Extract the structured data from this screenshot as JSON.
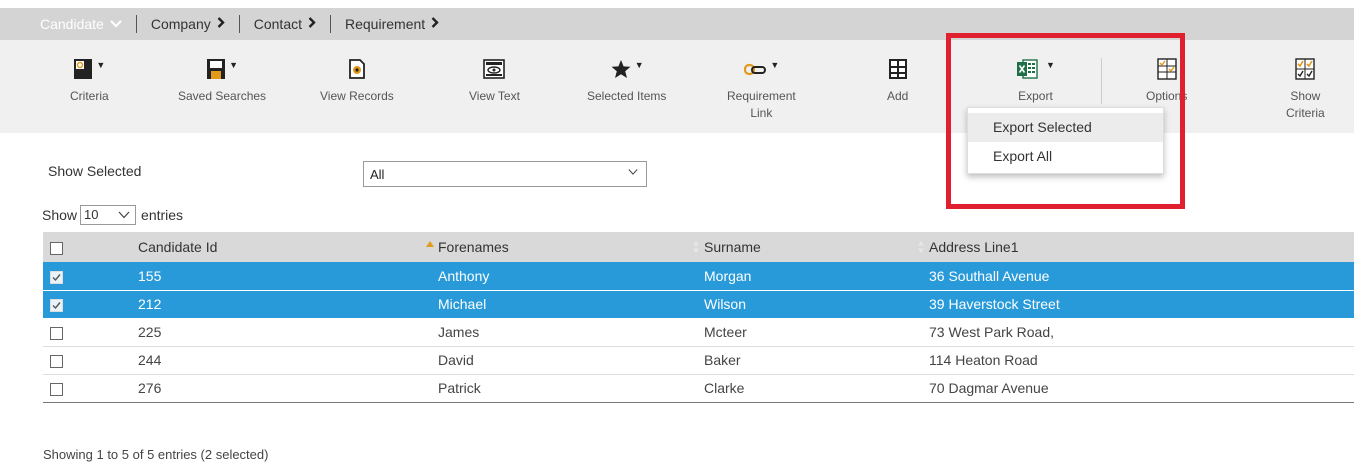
{
  "breadcrumb": [
    {
      "label": "Candidate",
      "active": true,
      "chevron": "chevron-down"
    },
    {
      "label": "Company",
      "active": false,
      "chevron": "chevron-right"
    },
    {
      "label": "Contact",
      "active": false,
      "chevron": "chevron-right"
    },
    {
      "label": "Requirement",
      "active": false,
      "chevron": "chevron-right"
    }
  ],
  "toolbar": {
    "criteria": "Criteria",
    "saved_searches": "Saved Searches",
    "view_records": "View Records",
    "view_text": "View Text",
    "selected_items": "Selected Items",
    "requirement_link_1": "Requirement",
    "requirement_link_2": "Link",
    "add": "Add",
    "export": "Export",
    "options": "Options",
    "show_criteria_1": "Show",
    "show_criteria_2": "Criteria"
  },
  "export_menu": {
    "items": [
      "Export Selected",
      "Export All"
    ],
    "hovered": "Export Selected"
  },
  "filter": {
    "label": "Show Selected",
    "value": "All"
  },
  "entries": {
    "prefix": "Show",
    "value": "10",
    "suffix": "entries"
  },
  "table": {
    "columns": [
      "Candidate Id",
      "Forenames",
      "Surname",
      "Address Line1"
    ],
    "sorted_column": "Candidate Id",
    "rows": [
      {
        "id": "155",
        "forenames": "Anthony",
        "surname": "Morgan",
        "address": "36 Southall Avenue",
        "selected": true
      },
      {
        "id": "212",
        "forenames": "Michael",
        "surname": "Wilson",
        "address": "39 Haverstock Street",
        "selected": true
      },
      {
        "id": "225",
        "forenames": "James",
        "surname": "Mcteer",
        "address": "73 West Park Road,",
        "selected": false
      },
      {
        "id": "244",
        "forenames": "David",
        "surname": "Baker",
        "address": "114 Heaton Road",
        "selected": false
      },
      {
        "id": "276",
        "forenames": "Patrick",
        "surname": "Clarke",
        "address": "70 Dagmar Avenue",
        "selected": false
      }
    ]
  },
  "footer": {
    "info": "Showing 1 to 5 of 5 entries (2 selected)"
  },
  "colors": {
    "selected_row": "#289ad9",
    "highlight_box": "#e0202e",
    "breadcrumb_bg": "#d4d4d4",
    "toolbar_bg": "#f0f0f0",
    "excel_green": "#1e7145"
  }
}
